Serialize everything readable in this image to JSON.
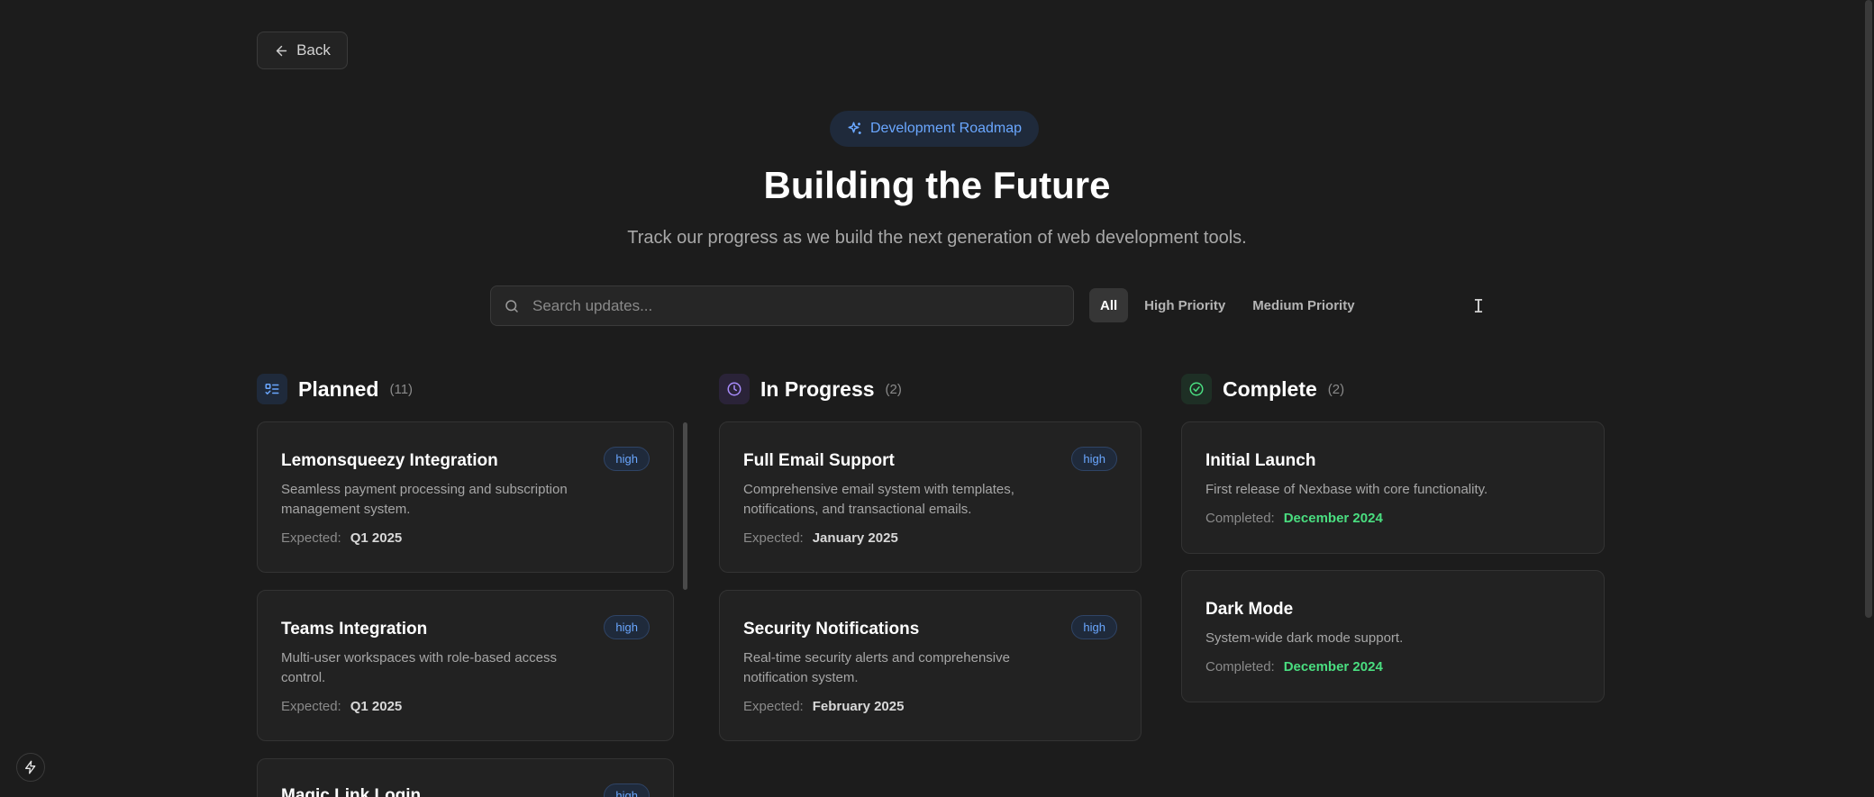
{
  "nav": {
    "back_label": "Back"
  },
  "hero": {
    "badge": "Development Roadmap",
    "title": "Building the Future",
    "subtitle": "Track our progress as we build the next generation of web development tools."
  },
  "search": {
    "placeholder": "Search updates..."
  },
  "filters": [
    "All",
    "High Priority",
    "Medium Priority"
  ],
  "columns": {
    "planned": {
      "title": "Planned",
      "count": "(11)",
      "cards": [
        {
          "title": "Lemonsqueezy Integration",
          "priority": "high",
          "desc_line1": "Seamless payment processing and subscription",
          "desc_line2": "management system.",
          "meta_label": "Expected:",
          "meta_value": "Q1 2025"
        },
        {
          "title": "Teams Integration",
          "priority": "high",
          "desc_line1": "Multi-user workspaces with role-based access",
          "desc_line2": "control.",
          "meta_label": "Expected:",
          "meta_value": "Q1 2025"
        },
        {
          "title": "Magic Link Login",
          "priority": "high"
        }
      ]
    },
    "in_progress": {
      "title": "In Progress",
      "count": "(2)",
      "cards": [
        {
          "title": "Full Email Support",
          "priority": "high",
          "desc_line1": "Comprehensive email system with templates,",
          "desc_line2": "notifications, and transactional emails.",
          "meta_label": "Expected:",
          "meta_value": "January 2025"
        },
        {
          "title": "Security Notifications",
          "priority": "high",
          "desc_line1": "Real-time security alerts and comprehensive",
          "desc_line2": "notification system.",
          "meta_label": "Expected:",
          "meta_value": "February 2025"
        }
      ]
    },
    "complete": {
      "title": "Complete",
      "count": "(2)",
      "cards": [
        {
          "title": "Initial Launch",
          "desc": "First release of Nexbase with core functionality.",
          "meta_label": "Completed:",
          "meta_value": "December 2024"
        },
        {
          "title": "Dark Mode",
          "desc": "System-wide dark mode support.",
          "meta_label": "Completed:",
          "meta_value": "December 2024"
        }
      ]
    }
  },
  "colors": {
    "background": "#1c1c1c",
    "accent_blue": "#6aa7ff",
    "complete_green": "#4ade80",
    "in_progress_purple": "#a78bfa"
  },
  "icons": {
    "back": "arrow-left-icon",
    "badge": "sparkles-icon",
    "search": "search-icon",
    "planned": "list-todo-icon",
    "in_progress": "clock-icon",
    "complete": "check-circle-icon",
    "bolt": "bolt-icon"
  }
}
